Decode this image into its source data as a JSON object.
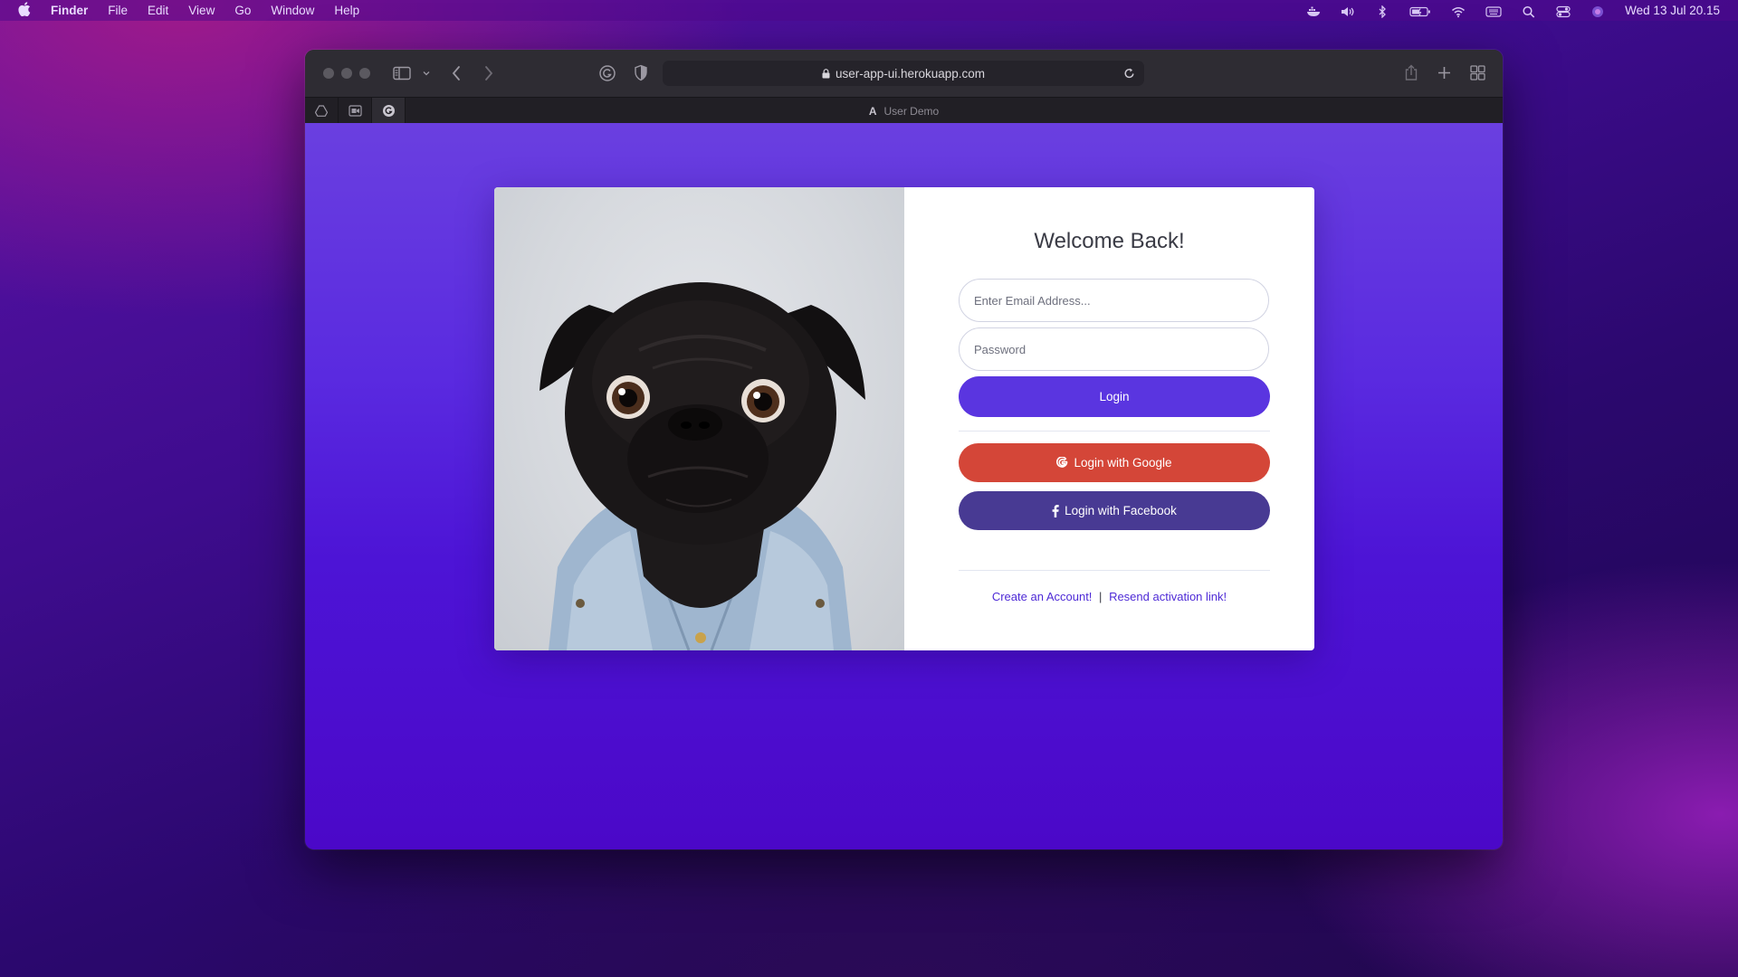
{
  "menubar": {
    "apple": "",
    "app": "Finder",
    "items": [
      "File",
      "Edit",
      "View",
      "Go",
      "Window",
      "Help"
    ],
    "clock": "Wed 13 Jul  20.15"
  },
  "browser": {
    "url": "user-app-ui.herokuapp.com",
    "tab_title": "User Demo",
    "tab_favicon_letter": "A"
  },
  "login": {
    "title": "Welcome Back!",
    "email_placeholder": "Enter Email Address...",
    "password_placeholder": "Password",
    "login_button": "Login",
    "google_button": "Login with Google",
    "facebook_button": "Login with Facebook",
    "create_account": "Create an Account!",
    "separator": "|",
    "resend_link": "Resend activation link!"
  },
  "colors": {
    "primary": "#5a35e0",
    "google": "#d44638",
    "facebook": "#483a93",
    "link": "#4e2ad6"
  }
}
